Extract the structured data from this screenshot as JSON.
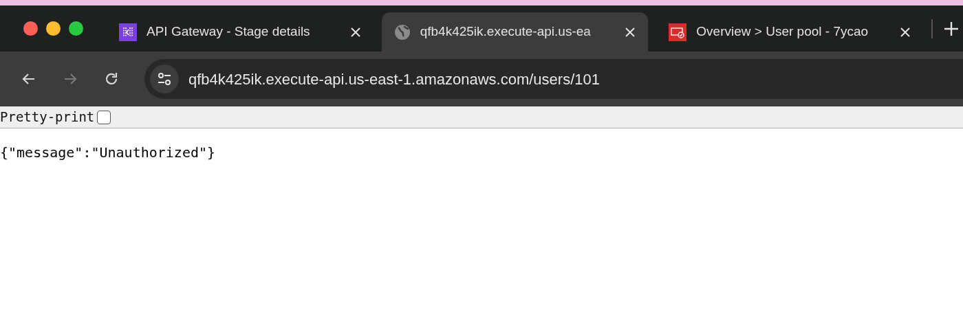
{
  "tabs": [
    {
      "title": "API Gateway - Stage details",
      "selected": false,
      "kind": "gateway"
    },
    {
      "title": "qfb4k425ik.execute-api.us-ea",
      "selected": true,
      "kind": "globe"
    },
    {
      "title": "Overview > User pool - 7ycao",
      "selected": false,
      "kind": "cognito"
    }
  ],
  "nav": [
    {
      "kind": "back",
      "disabled": false
    },
    {
      "kind": "forward",
      "disabled": true
    },
    {
      "kind": "reload",
      "disabled": false
    }
  ],
  "address": "qfb4k425ik.execute-api.us-east-1.amazonaws.com/users/101",
  "pretty_print": {
    "label": "Pretty-print",
    "checked": false
  },
  "body": "{\"message\":\"Unauthorized\"}"
}
